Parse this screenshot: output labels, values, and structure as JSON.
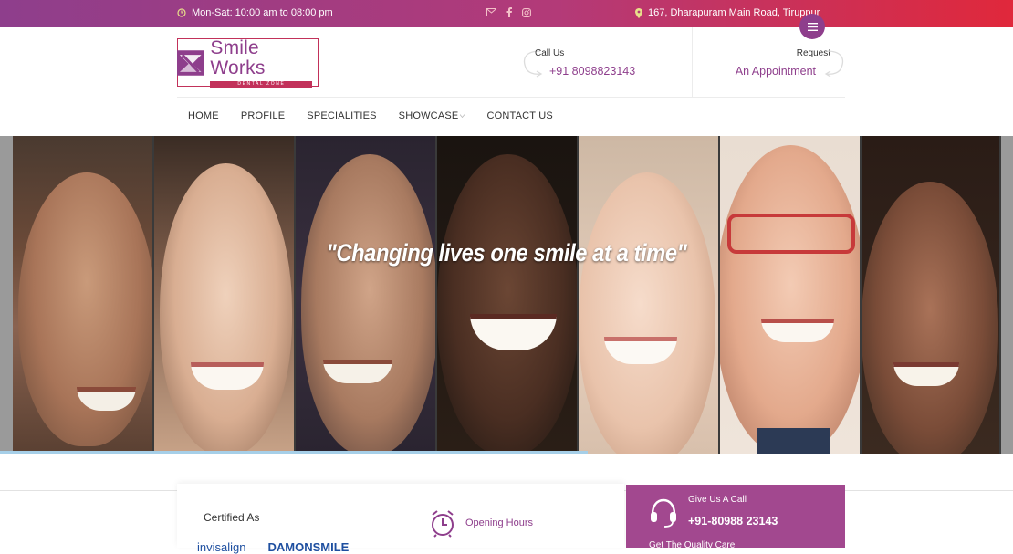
{
  "topbar": {
    "hours": "Mon-Sat: 10:00 am to 08:00 pm",
    "address": "167, Dharapuram Main Road, Tiruppur",
    "social_icons": [
      "mail-icon",
      "facebook-icon",
      "instagram-icon"
    ]
  },
  "brand": {
    "name": "Smile Works",
    "tagline": "DENTAL ZONE",
    "primary_color": "#8e3e8c",
    "accent_color": "#c2315a"
  },
  "header": {
    "call_label": "Call Us",
    "call_number": "+91 8098823143",
    "request_label": "Request",
    "request_text": "An Appointment"
  },
  "nav": {
    "items": [
      {
        "label": "HOME"
      },
      {
        "label": "PROFILE"
      },
      {
        "label": "SPECIALITIES"
      },
      {
        "label": "SHOWCASE"
      },
      {
        "label": "CONTACT US"
      }
    ]
  },
  "hero": {
    "quote": "\"Changing lives one smile at a time\"",
    "slider_progress": 0.58
  },
  "certified": {
    "title": "Certified As",
    "logos": [
      "invisalign",
      "DAMONSMILE"
    ]
  },
  "opening": {
    "label": "Opening Hours"
  },
  "callbox": {
    "line1": "Give Us A Call",
    "number": "+91-80988 23143",
    "line3": "Get The Quality Care"
  }
}
